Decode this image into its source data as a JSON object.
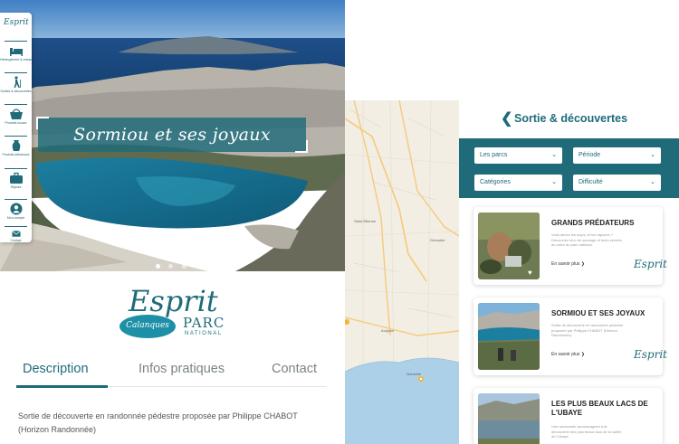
{
  "sidebar": {
    "logo": "Esprit",
    "items": [
      {
        "label": "Hébergement & restauration",
        "icon": "bed-icon"
      },
      {
        "label": "Sorties & découvertes",
        "icon": "hiker-icon"
      },
      {
        "label": "Produits locaux",
        "icon": "basket-icon"
      },
      {
        "label": "Produits artisanaux",
        "icon": "vase-icon"
      },
      {
        "label": "Séjours",
        "icon": "suitcase-icon"
      },
      {
        "label": "Mon compte",
        "icon": "user-icon"
      },
      {
        "label": "Contact",
        "icon": "mail-icon"
      }
    ]
  },
  "hero": {
    "title": "Sormiou et ses joyaux",
    "slide_count": 3,
    "active_slide": 1
  },
  "brand": {
    "esprit": "Esprit",
    "calanques": "Calanques",
    "parc": "PARC",
    "national": "NATIONAL"
  },
  "tabs": [
    {
      "label": "Description"
    },
    {
      "label": "Infos pratiques"
    },
    {
      "label": "Contact"
    }
  ],
  "description": "Sortie de découverte en randonnée pédestre proposée par Philippe CHABOT (Horizon Randonnée)",
  "map": {
    "labels": [
      "Saint-Étienne",
      "Grenoble",
      "Avignon",
      "Marseille"
    ]
  },
  "list": {
    "header": "Sortie & découvertes",
    "back_icon": "chevron-left-icon",
    "filters": [
      {
        "placeholder": "Les parcs"
      },
      {
        "placeholder": "Période"
      },
      {
        "placeholder": "Catégories"
      },
      {
        "placeholder": "Difficulté"
      }
    ],
    "cards": [
      {
        "title": "GRANDS PRÉDATEURS",
        "desc": "Vous aimez les loups, et les rapaces ? Découvrez leur vie sauvage et leurs secrets au cœur du parc national.",
        "more": "En savoir plus",
        "mark": "Esprit"
      },
      {
        "title": "SORMIOU ET SES JOYAUX",
        "desc": "Sortie de découverte en randonnée pédestre proposée par Philippe CHABOT (Horizon Randonnée).",
        "more": "En savoir plus",
        "mark": "Esprit"
      },
      {
        "title": "LES PLUS BEAUX LACS DE L'UBAYE",
        "desc": "Une randonnée accompagnée à la découverte des plus beaux lacs de la vallée de l'Ubaye.",
        "more": "",
        "mark": ""
      }
    ]
  },
  "colors": {
    "brand": "#1f6b7a",
    "brand_light": "#1d8fa6"
  }
}
